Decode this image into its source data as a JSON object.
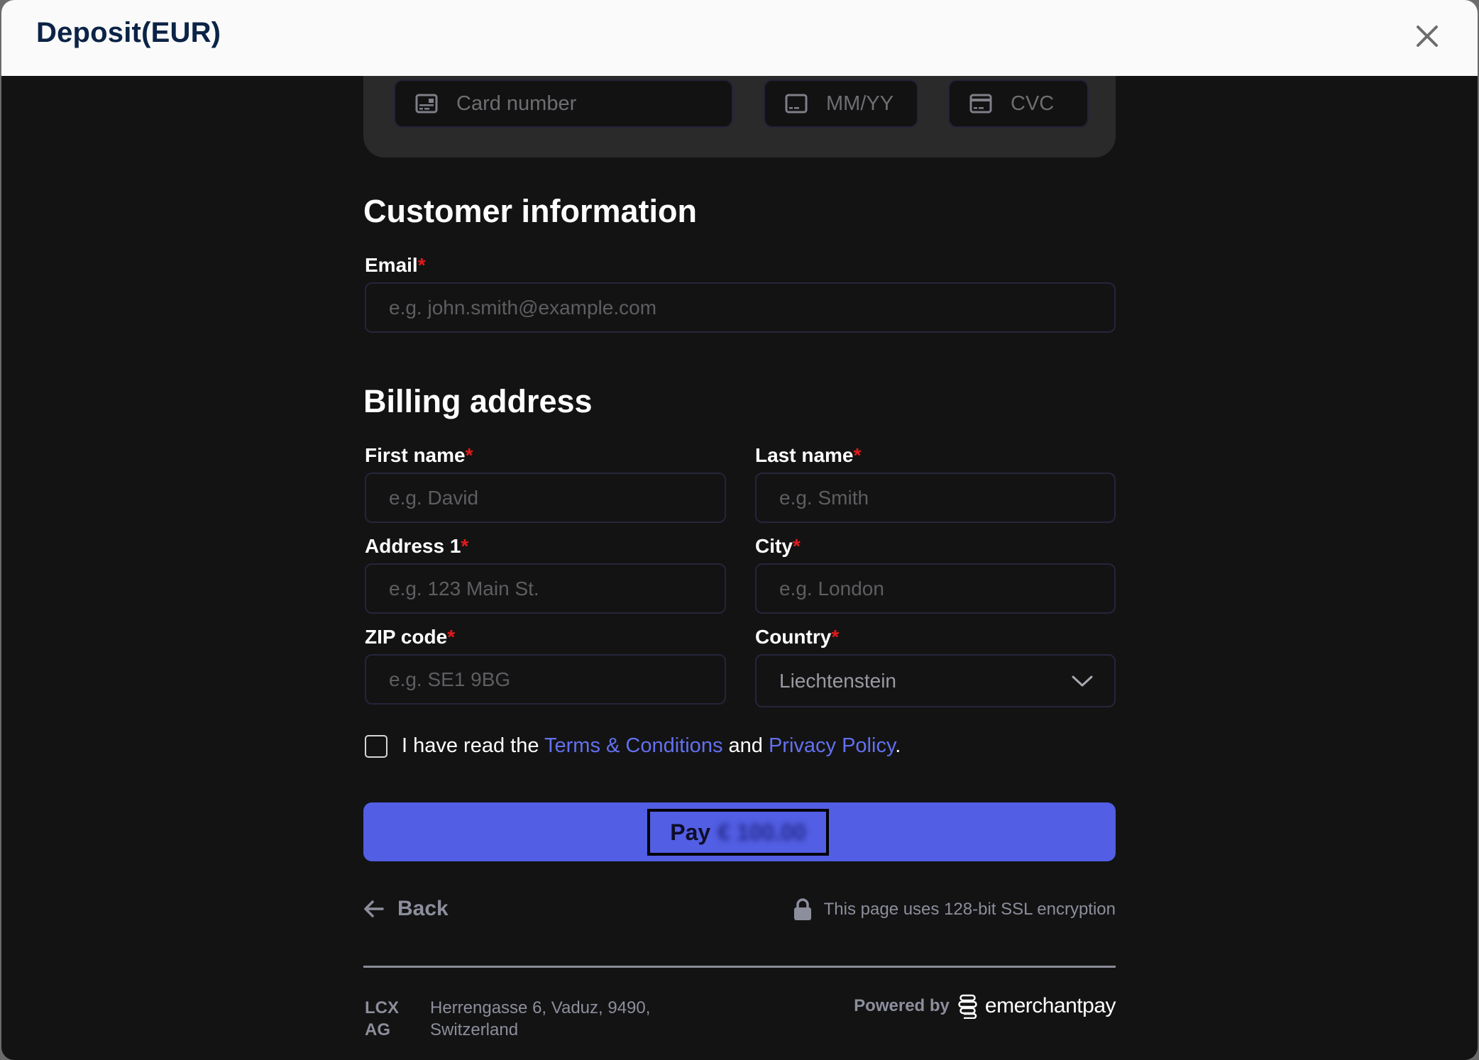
{
  "header": {
    "title": "Deposit(EUR)",
    "close_icon": "close-icon"
  },
  "card": {
    "number_placeholder": "Card number",
    "expiry_placeholder": "MM/YY",
    "cvc_placeholder": "CVC",
    "icons": [
      "card-front-icon",
      "card-expiry-icon",
      "card-back-icon"
    ]
  },
  "customer": {
    "heading": "Customer information",
    "email_label": "Email",
    "email_placeholder": "e.g. john.smith@example.com"
  },
  "billing": {
    "heading": "Billing address",
    "first_name_label": "First name",
    "first_name_placeholder": "e.g. David",
    "last_name_label": "Last name",
    "last_name_placeholder": "e.g. Smith",
    "address_label": "Address 1",
    "address_placeholder": "e.g. 123 Main St.",
    "city_label": "City",
    "city_placeholder": "e.g. London",
    "zip_label": "ZIP code",
    "zip_placeholder": "e.g. SE1 9BG",
    "country_label": "Country",
    "country_value": "Liechtenstein",
    "required_mark": "*"
  },
  "consent": {
    "prefix": "I have read the ",
    "terms_link": "Terms & Conditions",
    "middle": " and ",
    "privacy_link": "Privacy Policy",
    "suffix": ".",
    "checked": false
  },
  "pay": {
    "label": "Pay",
    "amount_blurred": "€ 100.00"
  },
  "footer": {
    "back_label": "Back",
    "ssl_text": "This page uses 128-bit SSL encryption",
    "company": "LCX AG",
    "address_line1": "Herrengasse 6, Vaduz, 9490,",
    "address_line2": "Switzerland",
    "powered_by": "Powered by",
    "brand": "emerchantpay"
  },
  "colors": {
    "accent": "#525ee3",
    "link": "#6370ee",
    "required": "#e21b1b",
    "title": "#0b2346",
    "background": "#131313"
  }
}
